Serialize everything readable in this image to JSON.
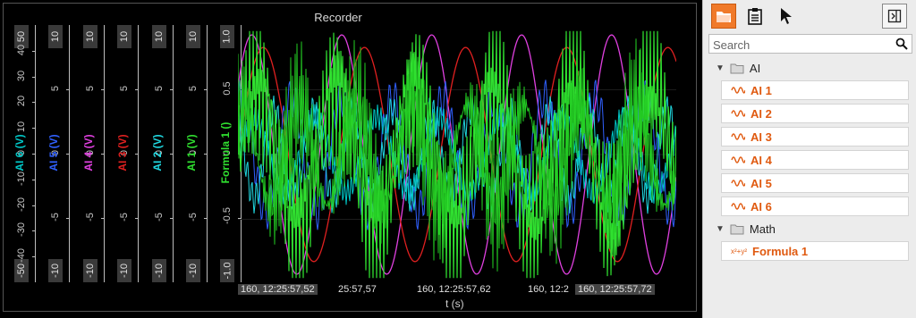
{
  "recorder": {
    "title": "Recorder",
    "x_axis_label": "t (s)",
    "time_labels": [
      "160, 12:25:57,52",
      "25:57,57",
      "160, 12:25:57,62",
      "160, 12:2",
      "160, 12:25:57,72"
    ],
    "axes": [
      {
        "name": "AI 6 (V)",
        "color": "#00c8c8",
        "max": "50",
        "min": "-50",
        "ticks": [
          "40",
          "30",
          "20",
          "10",
          "0",
          "-10",
          "-20",
          "-30",
          "-40"
        ]
      },
      {
        "name": "AI 5 (V)",
        "color": "#3060ff",
        "max": "10",
        "min": "-10",
        "ticks": [
          "5",
          "0",
          "-5"
        ]
      },
      {
        "name": "AI 4 (V)",
        "color": "#e040e0",
        "max": "10",
        "min": "-10",
        "ticks": [
          "5",
          "0",
          "-5"
        ]
      },
      {
        "name": "AI 3 (V)",
        "color": "#e02020",
        "max": "10",
        "min": "-10",
        "ticks": [
          "5",
          "0",
          "-5"
        ]
      },
      {
        "name": "AI 2 (V)",
        "color": "#20d8e0",
        "max": "10",
        "min": "-10",
        "ticks": [
          "5",
          "0",
          "-5"
        ]
      },
      {
        "name": "AI 1 (V)",
        "color": "#30e030",
        "max": "10",
        "min": "-10",
        "ticks": [
          "5",
          "0",
          "-5"
        ]
      },
      {
        "name": "Formula 1 ()",
        "color": "#30e030",
        "max": "1.0",
        "min": "-1.0",
        "ticks": [
          "0.5",
          "0",
          "-0.5"
        ]
      }
    ]
  },
  "sidebar": {
    "search_placeholder": "Search",
    "accent": "#e05a10",
    "groups": [
      {
        "label": "AI",
        "items": [
          "AI 1",
          "AI 2",
          "AI 3",
          "AI 4",
          "AI 5",
          "AI 6"
        ]
      },
      {
        "label": "Math",
        "items": [
          "Formula 1"
        ]
      }
    ],
    "toolbar_icons": [
      "open-folder-icon",
      "clipboard-icon",
      "pointer-icon",
      "dock-panel-icon"
    ]
  }
}
